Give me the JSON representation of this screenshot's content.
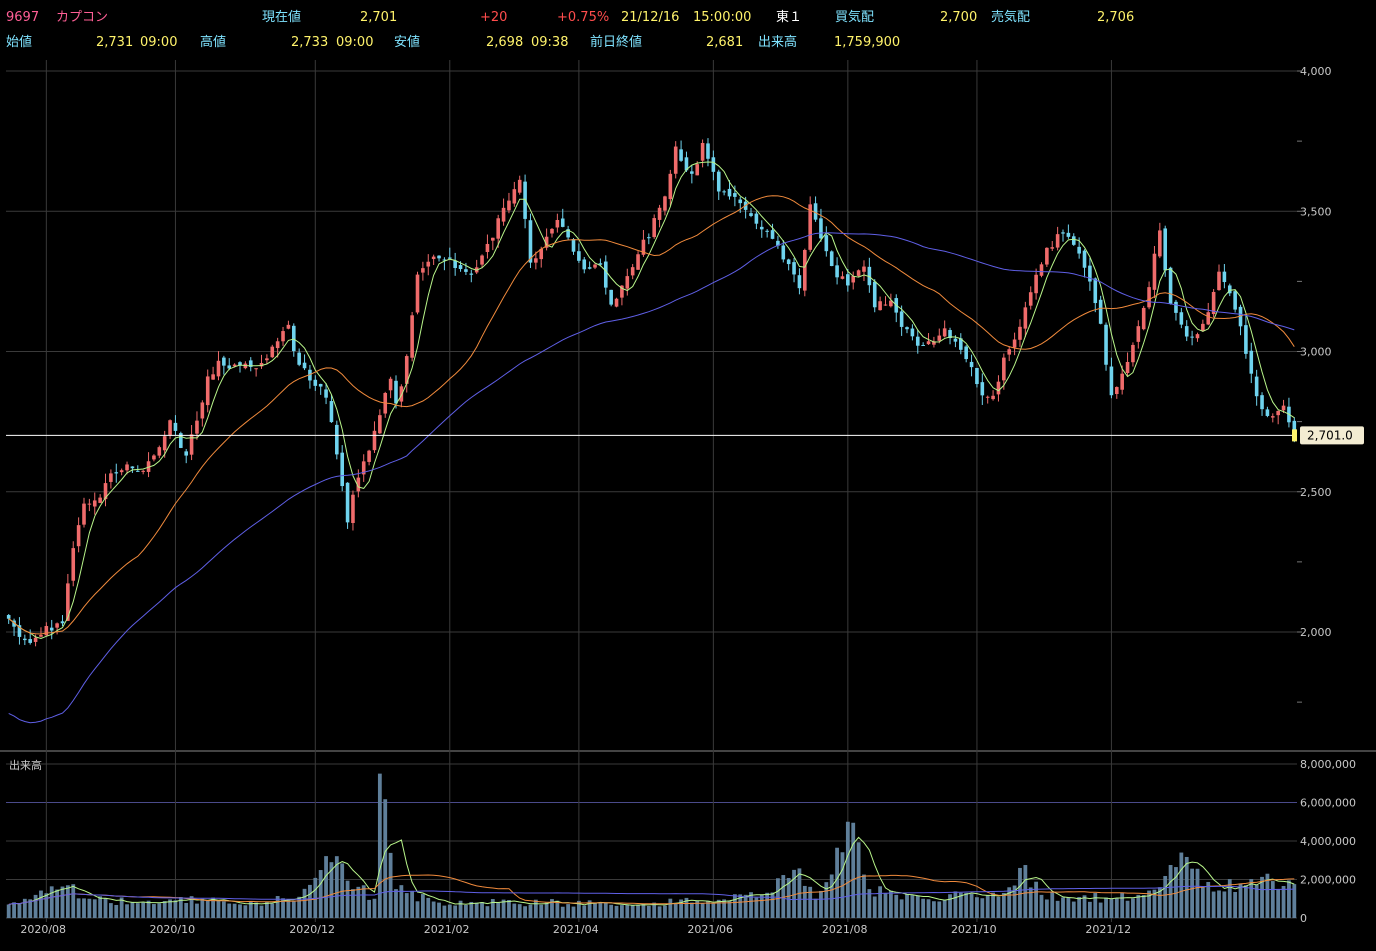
{
  "header": {
    "code": "9697",
    "name": "カプコン",
    "current_label": "現在値",
    "current_value": "2,701",
    "change": "+20",
    "change_pct": "+0.75%",
    "datetime": "21/12/16",
    "time": "15:00:00",
    "market": "東１",
    "bid_label": "買気配",
    "bid_value": "2,700",
    "ask_label": "売気配",
    "ask_value": "2,706",
    "open_label": "始値",
    "open_value": "2,731",
    "open_time": "09:00",
    "high_label": "高値",
    "high_value": "2,733",
    "high_time": "09:00",
    "low_label": "安値",
    "low_value": "2,698",
    "low_time": "09:38",
    "prev_label": "前日終値",
    "prev_value": "2,681",
    "volume_label": "出来高",
    "volume_value": "1,759,900"
  },
  "colors": {
    "up": "#ef6b6b",
    "down": "#6fd3ee",
    "ma_short": "#b8f58a",
    "ma_mid": "#f08a3c",
    "ma_long": "#5f5fe6",
    "grid": "#3a3a3a",
    "volume_bar": "#5f7f9a",
    "price_line": "#ffffff",
    "price_tag": "#f3ecd2"
  },
  "chart_data": {
    "type": "candlestick",
    "price_axis": {
      "ticks": [
        "4,000",
        "3,500",
        "3,000",
        "2,500",
        "2,000"
      ],
      "tick_values": [
        4000,
        3500,
        3000,
        2500,
        2000
      ],
      "ylim": [
        1750,
        4050
      ]
    },
    "volume_axis": {
      "label": "出来高",
      "ticks": [
        "8,000,000",
        "6,000,000",
        "4,000,000",
        "2,000,000",
        "0"
      ],
      "tick_values": [
        8000000,
        6000000,
        4000000,
        2000000,
        0
      ]
    },
    "x_axis": {
      "ticks": [
        "2020/08",
        "2020/10",
        "2020/12",
        "2021/02",
        "2021/04",
        "2021/06",
        "2021/08",
        "2021/10",
        "2021/12"
      ]
    },
    "current_price_label": "2,701.0",
    "current_price": 2701,
    "price_path": [
      [
        0,
        2060
      ],
      [
        3,
        1960
      ],
      [
        8,
        2020
      ],
      [
        10,
        2030
      ],
      [
        12,
        2300
      ],
      [
        14,
        2450
      ],
      [
        17,
        2480
      ],
      [
        19,
        2560
      ],
      [
        22,
        2590
      ],
      [
        24,
        2560
      ],
      [
        28,
        2650
      ],
      [
        30,
        2760
      ],
      [
        33,
        2620
      ],
      [
        37,
        2900
      ],
      [
        39,
        2960
      ],
      [
        43,
        2940
      ],
      [
        47,
        2960
      ],
      [
        50,
        3050
      ],
      [
        52,
        3080
      ],
      [
        54,
        2950
      ],
      [
        59,
        2850
      ],
      [
        61,
        2620
      ],
      [
        63,
        2400
      ],
      [
        64,
        2500
      ],
      [
        67,
        2660
      ],
      [
        69,
        2780
      ],
      [
        71,
        2900
      ],
      [
        72,
        2800
      ],
      [
        74,
        2980
      ],
      [
        76,
        3280
      ],
      [
        79,
        3350
      ],
      [
        82,
        3320
      ],
      [
        86,
        3280
      ],
      [
        89,
        3370
      ],
      [
        92,
        3510
      ],
      [
        95,
        3600
      ],
      [
        97,
        3320
      ],
      [
        100,
        3400
      ],
      [
        102,
        3480
      ],
      [
        105,
        3350
      ],
      [
        107,
        3290
      ],
      [
        110,
        3320
      ],
      [
        112,
        3160
      ],
      [
        115,
        3280
      ],
      [
        119,
        3420
      ],
      [
        122,
        3550
      ],
      [
        124,
        3720
      ],
      [
        127,
        3620
      ],
      [
        129,
        3740
      ],
      [
        132,
        3580
      ],
      [
        135,
        3560
      ],
      [
        137,
        3500
      ],
      [
        140,
        3430
      ],
      [
        142,
        3400
      ],
      [
        145,
        3310
      ],
      [
        147,
        3220
      ],
      [
        149,
        3530
      ],
      [
        151,
        3400
      ],
      [
        154,
        3260
      ],
      [
        156,
        3250
      ],
      [
        159,
        3300
      ],
      [
        161,
        3160
      ],
      [
        164,
        3180
      ],
      [
        166,
        3100
      ],
      [
        169,
        3010
      ],
      [
        171,
        3040
      ],
      [
        174,
        3070
      ],
      [
        177,
        3020
      ],
      [
        179,
        2940
      ],
      [
        181,
        2850
      ],
      [
        183,
        2830
      ],
      [
        185,
        2970
      ],
      [
        188,
        3100
      ],
      [
        191,
        3260
      ],
      [
        193,
        3360
      ],
      [
        196,
        3430
      ],
      [
        199,
        3360
      ],
      [
        201,
        3250
      ],
      [
        203,
        3100
      ],
      [
        205,
        2830
      ],
      [
        208,
        2960
      ],
      [
        210,
        3090
      ],
      [
        212,
        3240
      ],
      [
        214,
        3440
      ],
      [
        216,
        3160
      ],
      [
        219,
        3060
      ],
      [
        221,
        3050
      ],
      [
        223,
        3150
      ],
      [
        225,
        3270
      ],
      [
        227,
        3200
      ],
      [
        229,
        3080
      ],
      [
        231,
        2920
      ],
      [
        233,
        2780
      ],
      [
        235,
        2780
      ],
      [
        237,
        2820
      ],
      [
        239,
        2701
      ]
    ],
    "volume_path": [
      [
        0,
        700000
      ],
      [
        5,
        1200000
      ],
      [
        11,
        1700000
      ],
      [
        15,
        1000000
      ],
      [
        25,
        800000
      ],
      [
        36,
        1000000
      ],
      [
        46,
        800000
      ],
      [
        54,
        1100000
      ],
      [
        60,
        2900000
      ],
      [
        68,
        1000000
      ],
      [
        69,
        7500000
      ],
      [
        72,
        1500000
      ],
      [
        80,
        800000
      ],
      [
        100,
        800000
      ],
      [
        115,
        700000
      ],
      [
        128,
        900000
      ],
      [
        140,
        1200000
      ],
      [
        146,
        2500000
      ],
      [
        150,
        1000000
      ],
      [
        156,
        5000000
      ],
      [
        160,
        1500000
      ],
      [
        170,
        1000000
      ],
      [
        185,
        1300000
      ],
      [
        188,
        2600000
      ],
      [
        192,
        1200000
      ],
      [
        205,
        1000000
      ],
      [
        210,
        1200000
      ],
      [
        214,
        1600000
      ],
      [
        218,
        3400000
      ],
      [
        222,
        1600000
      ],
      [
        230,
        1700000
      ],
      [
        234,
        2300000
      ],
      [
        236,
        1500000
      ],
      [
        239,
        1759900
      ]
    ],
    "bar_count": 240
  }
}
